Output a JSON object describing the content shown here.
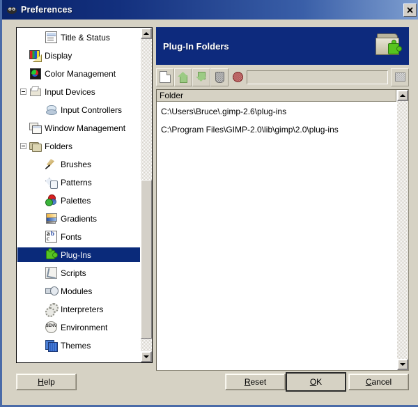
{
  "window": {
    "title": "Preferences",
    "title_icon": "gimp-wilber-icon",
    "close_label": "✕",
    "titlebar_color_start": "#0a246a",
    "titlebar_color_end": "#7f9fd0",
    "frame_color": "#4a6ba8",
    "face_color": "#d6d2c4"
  },
  "sidebar": {
    "name": "preferences-category-tree",
    "selected": "Plug-Ins",
    "selection_color": "#0a2a7a",
    "items": [
      {
        "label": "Title & Status",
        "icon": "title-status-icon",
        "indent": 2,
        "expander": null
      },
      {
        "label": "Display",
        "icon": "display-icon",
        "indent": 1,
        "expander": null
      },
      {
        "label": "Color Management",
        "icon": "color-management-icon",
        "indent": 1,
        "expander": null
      },
      {
        "label": "Input Devices",
        "icon": "input-devices-icon",
        "indent": 1,
        "expander": "expanded"
      },
      {
        "label": "Input Controllers",
        "icon": "input-controllers-icon",
        "indent": 2,
        "expander": null
      },
      {
        "label": "Window Management",
        "icon": "window-management-icon",
        "indent": 1,
        "expander": null
      },
      {
        "label": "Folders",
        "icon": "folders-icon",
        "indent": 1,
        "expander": "expanded"
      },
      {
        "label": "Brushes",
        "icon": "brushes-icon",
        "indent": 2,
        "expander": null
      },
      {
        "label": "Patterns",
        "icon": "patterns-icon",
        "indent": 2,
        "expander": null
      },
      {
        "label": "Palettes",
        "icon": "palettes-icon",
        "indent": 2,
        "expander": null
      },
      {
        "label": "Gradients",
        "icon": "gradients-icon",
        "indent": 2,
        "expander": null
      },
      {
        "label": "Fonts",
        "icon": "fonts-icon",
        "indent": 2,
        "expander": null
      },
      {
        "label": "Plug-Ins",
        "icon": "plug-ins-icon",
        "indent": 2,
        "expander": null
      },
      {
        "label": "Scripts",
        "icon": "scripts-icon",
        "indent": 2,
        "expander": null
      },
      {
        "label": "Modules",
        "icon": "modules-icon",
        "indent": 2,
        "expander": null
      },
      {
        "label": "Interpreters",
        "icon": "interpreters-icon",
        "indent": 2,
        "expander": null
      },
      {
        "label": "Environment",
        "icon": "environment-icon",
        "indent": 2,
        "expander": null
      },
      {
        "label": "Themes",
        "icon": "themes-icon",
        "indent": 2,
        "expander": null
      }
    ]
  },
  "pane": {
    "title": "Plug-In Folders",
    "header_icon": "folder-with-plugin-icon",
    "header_color": "#0d2a7d"
  },
  "toolbar": {
    "buttons": [
      {
        "name": "new-folder-button",
        "icon": "new-document-icon",
        "enabled": true
      },
      {
        "name": "move-up-button",
        "icon": "arrow-up-icon",
        "enabled": true
      },
      {
        "name": "move-down-button",
        "icon": "arrow-down-icon",
        "enabled": true
      },
      {
        "name": "delete-folder-button",
        "icon": "trash-icon",
        "enabled": false
      }
    ],
    "status_indicator": {
      "name": "folder-status-indicator",
      "icon": "red-circle-icon",
      "color": "#9d3a3a"
    },
    "path_input": {
      "value": "",
      "placeholder": ""
    },
    "browse_button": {
      "name": "browse-folder-button",
      "icon": "folder-browse-icon"
    }
  },
  "folder_list": {
    "column_header": "Folder",
    "rows": [
      "C:\\Users\\Bruce\\.gimp-2.6\\plug-ins",
      "C:\\Program Files\\GIMP-2.0\\lib\\gimp\\2.0\\plug-ins"
    ]
  },
  "footer": {
    "help": {
      "label": "Help",
      "mnemonic": "H"
    },
    "reset": {
      "label": "Reset",
      "mnemonic": "R"
    },
    "ok": {
      "label": "OK",
      "mnemonic": "O",
      "is_default": true
    },
    "cancel": {
      "label": "Cancel",
      "mnemonic": "C"
    }
  }
}
